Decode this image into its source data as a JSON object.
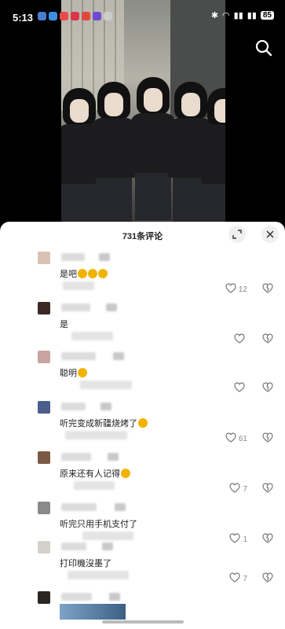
{
  "status_bar": {
    "time": "5:13",
    "battery": "85"
  },
  "sheet": {
    "title": "731条评论"
  },
  "comments": [
    {
      "text": "是吧",
      "emojis": 3,
      "likes": "12",
      "avatar_color": "#d9c2b3"
    },
    {
      "text": "是",
      "emojis": 0,
      "likes": "",
      "avatar_color": "#3b2a24"
    },
    {
      "text": "聪明",
      "emojis": 1,
      "likes": "",
      "avatar_color": "#c9a3a0"
    },
    {
      "text": "听完变成新疆烧烤了",
      "emojis": 1,
      "likes": "61",
      "avatar_color": "#4c5d8a"
    },
    {
      "text": "原来还有人记得",
      "emojis": 1,
      "likes": "7",
      "avatar_color": "#7b5a45"
    },
    {
      "text": "听完只用手机支付了",
      "emojis": 0,
      "likes": "1",
      "avatar_color": "#8a8a8a"
    },
    {
      "text": "打印機沒墨了",
      "emojis": 0,
      "likes": "7",
      "avatar_color": "#d4d1cc"
    },
    {
      "text": "",
      "emojis": 0,
      "likes": "",
      "avatar_color": "#2b2622"
    }
  ],
  "colors": {
    "sheet_bg": "#ffffff",
    "icon_gray": "#666666"
  }
}
